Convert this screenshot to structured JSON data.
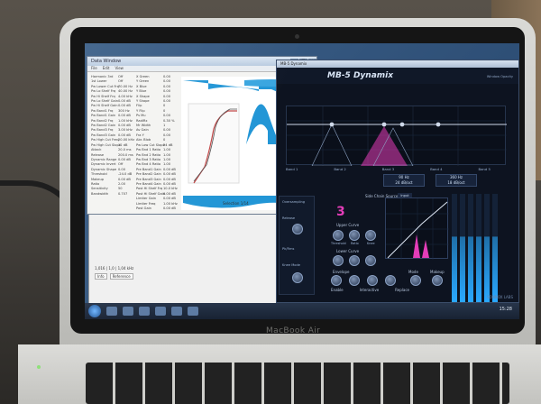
{
  "laptop": {
    "brand": "MacBook Air"
  },
  "data_window": {
    "title": "Data Window",
    "menu": [
      "File",
      "Edit",
      "View"
    ],
    "col1": [
      "Harmonic 3rd",
      "1st Lower",
      "Pw Lower Cut Frq",
      "Pw Lo Shelf Frq",
      "Pw Hi Shelf Frq",
      "Pw Lo Shelf Gain",
      "Pw Hi Shelf Gain",
      "Pw Band1 Frq",
      "Pw Band1 Gain",
      "Pw Band2 Frq",
      "Pw Band2 Gain",
      "Pw Band3 Frq",
      "Pw Band3 Gain",
      "Pw High Cut Freq",
      "Pw High Cut Slope",
      "Attack",
      "Release",
      "Dynamic Range",
      "Dynamic Invert",
      "Dynamic Shape",
      "Threshold",
      "Makeup",
      "Ratio",
      "Sensitivity",
      "Bandwidth"
    ],
    "col2": [
      "Off",
      "Off",
      "70.00 Hz",
      "40.00 Hz",
      "4.00 kHz",
      "0.00 dB",
      "0.00 dB",
      "300 Hz",
      "0.00 dB",
      "1.00 kHz",
      "0.00 dB",
      "3.00 kHz",
      "0.00 dB",
      "20.00 kHz",
      "12 dB",
      "20.0 ms",
      "200.0 ms",
      "0.00 dB",
      "Off",
      "0.00",
      "-24.0 dB",
      "0.00 dB",
      "2.00",
      "50",
      "0.707"
    ],
    "col3": [
      "X Green",
      "Y Green",
      "X Blue",
      "Y Blue",
      "X Shape",
      "Y Shape",
      "Flip",
      "Y Flip",
      "Ps Mu",
      "RadiRx",
      "Mr Width",
      "Av Gain",
      "Fra Y",
      "Abr. Blob",
      "Pw Low Cut Slope",
      "Pw Bnd 1 Ratio",
      "Pw Bnd 2 Ratio",
      "Pw Bnd 3 Ratio",
      "Pw Bnd 4 Ratio",
      "Pre Band1 Gain",
      "Pre Band2 Gain",
      "Pre Band3 Gain",
      "Pre Band4 Gain",
      "Post Hi Shelf Frq",
      "Post Hi Shelf Gain",
      "Limiter Gain",
      "Limiter Freq",
      "Post Gain"
    ],
    "col4": [
      "0.00",
      "0.00",
      "0.00",
      "0.00",
      "0.00",
      "0.00",
      "0",
      "0",
      "0.00",
      "0.30 %",
      "1",
      "0.00",
      "0.00",
      "0",
      "24 dB",
      "1.00",
      "1.00",
      "1.00",
      "1.00",
      "0.00 dB",
      "0.00 dB",
      "0.00 dB",
      "0.00 dB",
      "10.0 kHz",
      "0.00 dB",
      "0.00 dB",
      "1.00 kHz",
      "0.00 dB"
    ],
    "selection": "Selection 1/14"
  },
  "bg_app": {
    "tabs": [
      "Info",
      "Reference"
    ],
    "status": "1,016 | 1,0 | 1,04 kHz"
  },
  "plugin": {
    "window_title": "MB-5 Dynamix",
    "logo": "MB-5 Dynamix",
    "presets_label": "Window Opacity",
    "band_labels": [
      "Band 1",
      "Band 2",
      "Band 3",
      "Band 4",
      "Band 5"
    ],
    "freq1": "90 Hz",
    "freq1b": "24 dB/oct",
    "freq2": "360 Hz",
    "freq2b": "18 dB/oct",
    "band_number": "3",
    "sidechain_label": "Side Chain Source",
    "sidechain_value": "Input",
    "upper_curve": "Upper Curve",
    "lower_curve": "Lower Curve",
    "knob_labels": [
      "Threshold",
      "Ratio",
      "Knee"
    ],
    "envelope": "Envelope",
    "mode": "Mode",
    "makeup": "Makeup",
    "env_labels": [
      "Attack",
      "Hold",
      "Release",
      "Sag Avg"
    ],
    "env_values": [
      "1.0 ms",
      "0.0 ms",
      "95 ms",
      "0.0 dB"
    ],
    "left_labels": [
      "Oversampling",
      "Release",
      "Pk/Rms",
      "Knee Mode"
    ],
    "bottom": [
      "Enable",
      "Interactive",
      "Replace"
    ],
    "brand": "SONNOX LABS"
  },
  "taskbar": {
    "clock": "15:28"
  },
  "colors": {
    "plot_blue": "#2296d6",
    "accent_magenta": "#e33db8",
    "window_bg": "#f4f4f2"
  }
}
